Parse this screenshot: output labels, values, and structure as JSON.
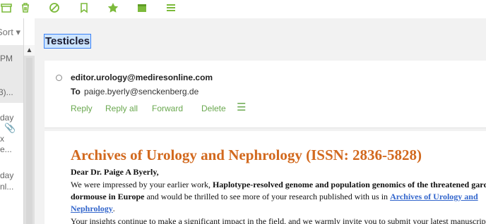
{
  "toolbar": {
    "icons": [
      "archive-icon",
      "trash-icon",
      "block-icon",
      "bookmark-icon",
      "star-icon",
      "folder-icon",
      "menu-icon"
    ],
    "accent_color": "#7cba3b"
  },
  "list": {
    "sort_label": "Sort ▾",
    "items": [
      {
        "line1": "PM",
        "line2": "",
        "line3": "3)..."
      },
      {
        "line1": "day",
        "line2": "",
        "line3": "x",
        "line4": "e..."
      },
      {
        "line1": "day",
        "line2": "nl..."
      }
    ]
  },
  "email": {
    "subject": "Testicles",
    "from": "editor.urology@mediresonline.com",
    "to_label": "To",
    "to": "paige.byerly@senckenberg.de",
    "actions": [
      "Reply",
      "Reply all",
      "Forward",
      "Delete"
    ],
    "journal_title": "Archives of Urology and Nephrology (ISSN: 2836-5828)",
    "greeting": "Dear Dr. Paige A Byerly,",
    "para1_a": "We were impressed by your earlier work, ",
    "para1_b": "Haplotype-resolved genome and population genomics of the threatened garden",
    "para1_c": "dormouse in Europe",
    "para1_d": " and would be thrilled to see more of your research published with us in ",
    "para1_link1": "Archives of Urology and",
    "para1_link2": "Nephrology",
    "para1_end": ".",
    "para2": "Your insights continue to make a significant impact in the field, and we warmly invite you to submit your latest manuscript for"
  }
}
